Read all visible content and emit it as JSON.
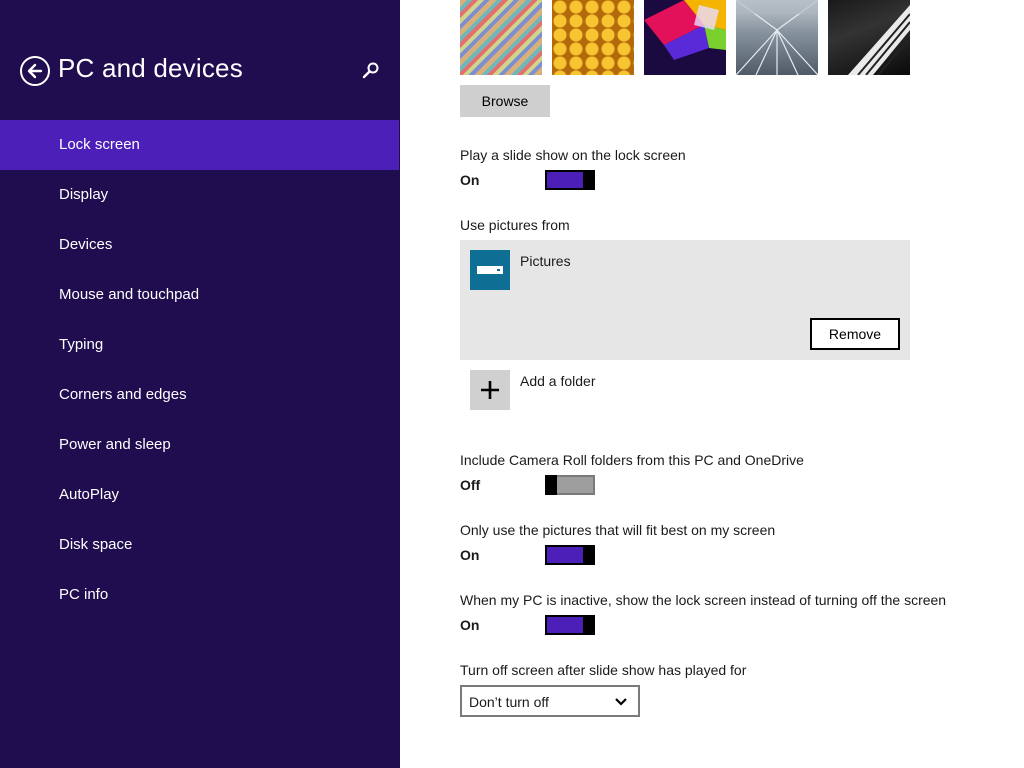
{
  "sidebar": {
    "title": "PC and devices",
    "items": [
      {
        "label": "Lock screen",
        "selected": true
      },
      {
        "label": "Display"
      },
      {
        "label": "Devices"
      },
      {
        "label": "Mouse and touchpad"
      },
      {
        "label": "Typing"
      },
      {
        "label": "Corners and edges"
      },
      {
        "label": "Power and sleep"
      },
      {
        "label": "AutoPlay"
      },
      {
        "label": "Disk space"
      },
      {
        "label": "PC info"
      }
    ]
  },
  "lock_screen": {
    "browse_label": "Browse",
    "slideshow": {
      "label": "Play a slide show on the lock screen",
      "state": "On"
    },
    "use_pictures_from": {
      "label": "Use pictures from",
      "folders": [
        {
          "name": "Pictures"
        }
      ],
      "remove_label": "Remove",
      "add_folder_label": "Add a folder"
    },
    "camera_roll": {
      "label": "Include Camera Roll folders from this PC and OneDrive",
      "state": "Off"
    },
    "fit_best": {
      "label": "Only use the pictures that will fit best on my screen",
      "state": "On"
    },
    "inactive": {
      "label": "When my PC is inactive, show the lock screen instead of turning off the screen",
      "state": "On"
    },
    "turn_off": {
      "label": "Turn off screen after slide show has played for",
      "selected": "Don’t turn off"
    }
  },
  "colors": {
    "sidebar_bg": "#1f0d4f",
    "accent": "#4c1fb8",
    "folder_tile": "#0e6e93"
  }
}
